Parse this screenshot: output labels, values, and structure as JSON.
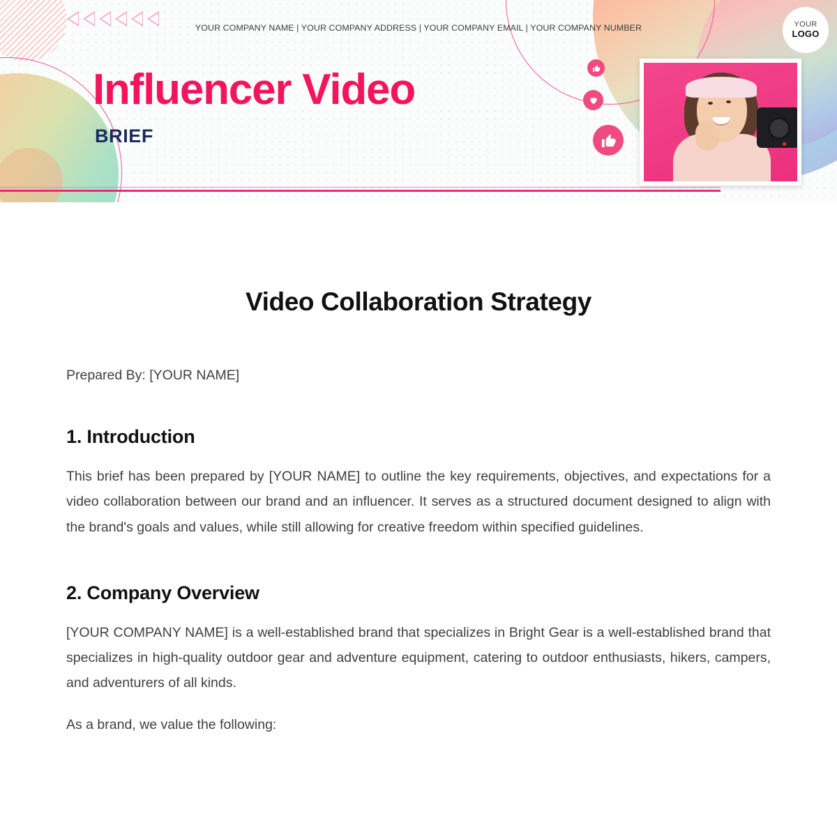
{
  "banner": {
    "contact_line": "YOUR COMPANY NAME | YOUR COMPANY ADDRESS | YOUR COMPANY EMAIL | YOUR COMPANY NUMBER",
    "logo_line1": "YOUR",
    "logo_line2": "LOGO",
    "title_main": "Influencer Video",
    "title_sub": "BRIEF",
    "reaction_icons": [
      "thumbs-up-small",
      "heart",
      "thumbs-up-large"
    ],
    "reaction_glyphs": [
      "👍",
      "♥",
      "👍"
    ],
    "decorations": [
      "hatched-circle",
      "gradient-blob-right",
      "gradient-blob-left",
      "pink-ring-top",
      "pink-ring-left",
      "triangle-row",
      "dot-texture"
    ],
    "triangle_count": 6,
    "colors": {
      "title_pink": "#f4145e",
      "subtitle_navy": "#1b2a5e",
      "rule_pink": "#ec2a7b",
      "reaction_pink": "#ef4b7f",
      "photo_background_pink": "#ef3a84"
    }
  },
  "document": {
    "title": "Video Collaboration Strategy",
    "prepared_by": "Prepared By: [YOUR NAME]",
    "sections": [
      {
        "heading": "1. Introduction",
        "body": "This brief has been prepared by [YOUR NAME] to outline the key requirements, objectives, and expectations for a video collaboration between our brand and an influencer. It serves as a structured document designed to align with the brand's goals and values, while still allowing for creative freedom within specified guidelines."
      },
      {
        "heading": "2. Company Overview",
        "body": "[YOUR COMPANY NAME] is a well-established brand that specializes in Bright Gear is a well-established brand that specializes in high-quality outdoor gear and adventure equipment, catering to outdoor enthusiasts, hikers, campers, and adventurers of all kinds.",
        "body2": "As a brand, we value the following:"
      }
    ]
  }
}
